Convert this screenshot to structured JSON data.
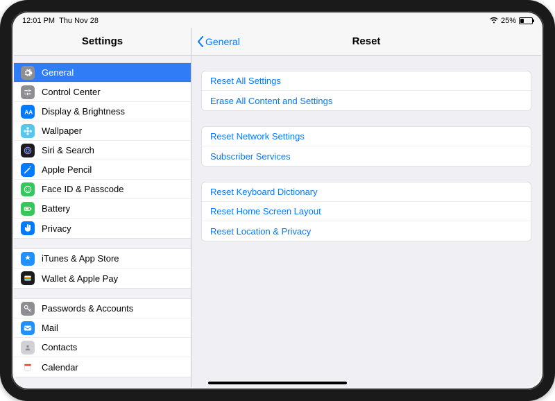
{
  "status": {
    "time": "12:01 PM",
    "date": "Thu Nov 28",
    "battery_text": "25%"
  },
  "sidebar": {
    "title": "Settings",
    "groups": [
      [
        {
          "id": "general",
          "label": "General",
          "icon": "gear",
          "color": "#8e8e93",
          "selected": true
        },
        {
          "id": "control-center",
          "label": "Control Center",
          "icon": "sliders",
          "color": "#8e8e93"
        },
        {
          "id": "display",
          "label": "Display & Brightness",
          "icon": "text",
          "color": "#007aff"
        },
        {
          "id": "wallpaper",
          "label": "Wallpaper",
          "icon": "flower",
          "color": "#54c7ec"
        },
        {
          "id": "siri",
          "label": "Siri & Search",
          "icon": "siri",
          "color": "#1c1c1e"
        },
        {
          "id": "pencil",
          "label": "Apple Pencil",
          "icon": "pencil",
          "color": "#007aff"
        },
        {
          "id": "faceid",
          "label": "Face ID & Passcode",
          "icon": "face",
          "color": "#34c759"
        },
        {
          "id": "battery",
          "label": "Battery",
          "icon": "battery",
          "color": "#34c759"
        },
        {
          "id": "privacy",
          "label": "Privacy",
          "icon": "hand",
          "color": "#007aff"
        }
      ],
      [
        {
          "id": "itunes",
          "label": "iTunes & App Store",
          "icon": "appstore",
          "color": "#1e90ff"
        },
        {
          "id": "wallet",
          "label": "Wallet & Apple Pay",
          "icon": "wallet",
          "color": "#1c1c1e"
        }
      ],
      [
        {
          "id": "passwords",
          "label": "Passwords & Accounts",
          "icon": "key",
          "color": "#8e8e93"
        },
        {
          "id": "mail",
          "label": "Mail",
          "icon": "mail",
          "color": "#1e90ff"
        },
        {
          "id": "contacts",
          "label": "Contacts",
          "icon": "contacts",
          "color": "#d1d1d6"
        },
        {
          "id": "calendar",
          "label": "Calendar",
          "icon": "calendar",
          "color": "#ffffff"
        }
      ]
    ]
  },
  "detail": {
    "back_label": "General",
    "title": "Reset",
    "groups": [
      [
        {
          "id": "reset-all",
          "label": "Reset All Settings"
        },
        {
          "id": "erase-all",
          "label": "Erase All Content and Settings"
        }
      ],
      [
        {
          "id": "reset-network",
          "label": "Reset Network Settings"
        },
        {
          "id": "subscriber",
          "label": "Subscriber Services"
        }
      ],
      [
        {
          "id": "reset-keyboard",
          "label": "Reset Keyboard Dictionary"
        },
        {
          "id": "reset-home",
          "label": "Reset Home Screen Layout"
        },
        {
          "id": "reset-location",
          "label": "Reset Location & Privacy"
        }
      ]
    ]
  }
}
